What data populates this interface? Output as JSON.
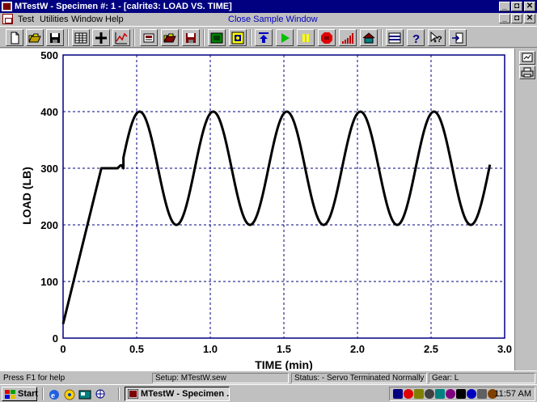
{
  "window": {
    "title": "MTestW - Specimen #:  1 - [calrite3: LOAD VS. TIME]",
    "caption_buttons": [
      "_",
      "◘",
      "✕"
    ]
  },
  "menu": {
    "items": [
      "Test",
      "Utilities",
      "Window",
      "Help"
    ],
    "close_sample": "Close Sample Window",
    "mdi_buttons": [
      "_",
      "◘",
      "✕"
    ]
  },
  "toolbar": {
    "icons": [
      "new-file-icon",
      "open-folder-icon",
      "save-disk-icon",
      "table-view-icon",
      "crosshair-icon",
      "graph-icon",
      "setup-icon",
      "open-setup-icon",
      "save-setup-icon",
      "green-board-icon",
      "yellow-counter-icon",
      "return-icon",
      "play-icon",
      "pause-icon",
      "stop-icon",
      "ramp-icon",
      "home-icon",
      "grid-icon",
      "help-icon",
      "context-help-icon",
      "exit-icon"
    ]
  },
  "side_panel": {
    "icons": [
      "graph-options-icon",
      "print-icon"
    ]
  },
  "chart_data": {
    "type": "line",
    "xlabel": "TIME  (min)",
    "ylabel": "LOAD  (LB)",
    "xlim": [
      0,
      3.0
    ],
    "ylim": [
      0,
      500
    ],
    "xticks": [
      "0",
      "0.5",
      "1.0",
      "1.5",
      "2.0",
      "2.5",
      "3.0"
    ],
    "yticks": [
      "0",
      "100",
      "200",
      "300",
      "400",
      "500"
    ],
    "grid": true,
    "series": [
      {
        "color": "#000000",
        "segments": [
          {
            "kind": "points",
            "x": [
              0,
              0.26,
              0.37,
              0.39,
              0.4,
              0.41
            ],
            "y": [
              25,
              300,
              300,
              305,
              305,
              300
            ]
          },
          {
            "kind": "sine",
            "x_start": 0.41,
            "x_end": 2.9,
            "period": 0.5,
            "mean": 300,
            "amplitude": 100,
            "peak_at": 0.52
          }
        ]
      }
    ]
  },
  "status": {
    "help": "Press F1 for help",
    "setup": "Setup: MTestW.sew",
    "state": "Status:  - Servo Terminated Normally",
    "gear": "Gear: L"
  },
  "taskbar": {
    "start": "Start",
    "task": "MTestW - Specimen ...",
    "clock": "11:57 AM",
    "quicklaunch": [
      "ie-icon",
      "outlook-icon",
      "desktop-icon",
      "channels-icon"
    ],
    "tray": [
      "network-icon",
      "red-icon",
      "speaker-icon",
      "volume-icon",
      "scheduler-icon",
      "pen-icon",
      "clock-icon",
      "sync-icon",
      "lock-icon",
      "disk-icon"
    ]
  }
}
